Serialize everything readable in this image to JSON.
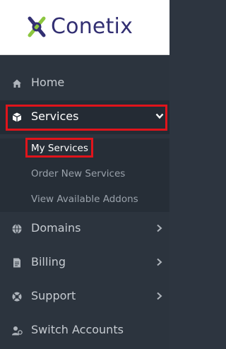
{
  "brand": {
    "name": "Conetix",
    "logo_color": "#322f72",
    "logo_accent": "#8cc63f"
  },
  "nav": {
    "items": [
      {
        "label": "Home",
        "icon": "home-icon"
      },
      {
        "label": "Services",
        "icon": "cube-icon",
        "expanded": true
      },
      {
        "label": "Domains",
        "icon": "globe-icon"
      },
      {
        "label": "Billing",
        "icon": "invoice-icon"
      },
      {
        "label": "Support",
        "icon": "lifebuoy-icon"
      },
      {
        "label": "Switch Accounts",
        "icon": "users-icon"
      }
    ],
    "services_submenu": [
      {
        "label": "My Services",
        "current": true
      },
      {
        "label": "Order New Services"
      },
      {
        "label": "View Available Addons"
      }
    ]
  },
  "colors": {
    "sidebar_bg": "#2c343e",
    "highlight": "#e0141b"
  }
}
